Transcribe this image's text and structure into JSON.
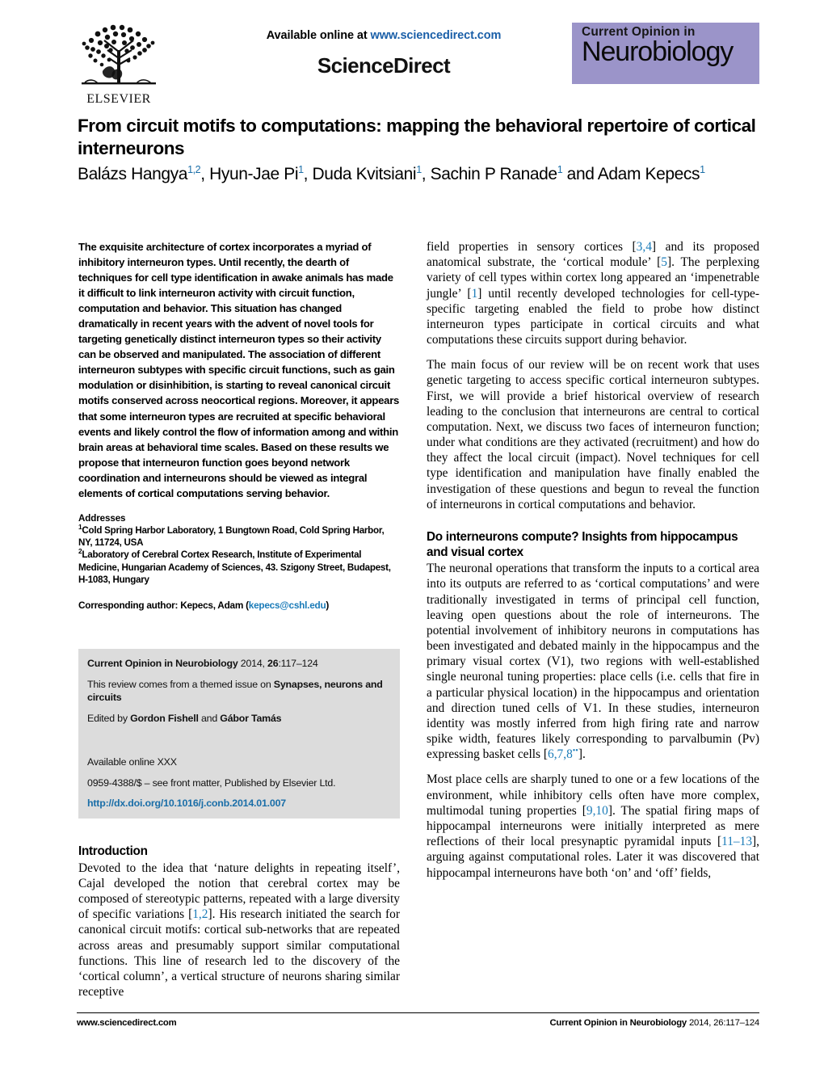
{
  "masthead": {
    "available_online_prefix": "Available online at ",
    "sciencedirect_url": "www.sciencedirect.com",
    "sciencedirect_wordmark": "ScienceDirect",
    "publisher_name": "ELSEVIER",
    "journal_logo_line1": "Current Opinion in",
    "journal_logo_line2": "Neurobiology",
    "journal_logo_bg": "#9b94c9"
  },
  "article": {
    "title": "From circuit motifs to computations: mapping the behavioral repertoire of cortical interneurons",
    "authors_html": "Balázs Hangya<sup>1,2</sup>, Hyun-Jae Pi<sup>1</sup>, Duda Kvitsiani<sup>1</sup>, Sachin P Ranade<sup>1</sup> and Adam Kepecs<sup>1</sup>"
  },
  "abstract": {
    "text": "The exquisite architecture of cortex incorporates a myriad of inhibitory interneuron types. Until recently, the dearth of techniques for cell type identification in awake animals has made it difficult to link interneuron activity with circuit function, computation and behavior. This situation has changed dramatically in recent years with the advent of novel tools for targeting genetically distinct interneuron types so their activity can be observed and manipulated. The association of different interneuron subtypes with specific circuit functions, such as gain modulation or disinhibition, is starting to reveal canonical circuit motifs conserved across neocortical regions. Moreover, it appears that some interneuron types are recruited at specific behavioral events and likely control the flow of information among and within brain areas at behavioral time scales. Based on these results we propose that interneuron function goes beyond network coordination and interneurons should be viewed as integral elements of cortical computations serving behavior."
  },
  "addresses": {
    "heading": "Addresses",
    "address1_marker": "1",
    "address1": "Cold Spring Harbor Laboratory, 1 Bungtown Road, Cold Spring Harbor, NY, 11724, USA",
    "address2_marker": "2",
    "address2": "Laboratory of Cerebral Cortex Research, Institute of Experimental Medicine, Hungarian Academy of Sciences, 43. Szigony Street, Budapest, H-1083, Hungary",
    "corresponding_prefix": "Corresponding author: Kepecs, Adam (",
    "corresponding_email": "kepecs@cshl.edu",
    "corresponding_suffix": ")"
  },
  "citation_box": {
    "journal_bold": "Current Opinion in Neurobiology",
    "citation_rest": " 2014, ",
    "volume_bold": "26",
    "pages": ":117–124",
    "themed_prefix": "This review comes from a themed issue on ",
    "themed_issue_bold": "Synapses, neurons and circuits",
    "edited_prefix": "Edited by ",
    "editor1": "Gordon Fishell",
    "edited_mid": " and ",
    "editor2": "Gábor Tamás",
    "available_online": "Available online XXX",
    "front_matter": "0959-4388/$ – see front matter, Published by Elsevier Ltd.",
    "doi": "http://dx.doi.org/10.1016/j.conb.2014.01.007"
  },
  "sections": {
    "introduction_heading": "Introduction",
    "interneurons_heading": "Do interneurons compute? Insights from hippocampus and visual cortex"
  },
  "paragraphs": {
    "intro_p1_a": "Devoted to the idea that ‘nature delights in repeating itself’, Cajal developed the notion that cerebral cortex may be composed of stereotypic patterns, repeated with a large diversity of specific variations [",
    "intro_p1_ref": "1,2",
    "intro_p1_b": "]. His research initiated the search for canonical circuit motifs: cortical sub-networks that are repeated across areas and presumably support similar computational functions. This line of research led to the discovery of the ‘cortical column’, a vertical structure of neurons sharing similar receptive",
    "right_p1_a": "field properties in sensory cortices [",
    "right_p1_ref1": "3,4",
    "right_p1_b": "] and its proposed anatomical substrate, the ‘cortical module’ [",
    "right_p1_ref2": "5",
    "right_p1_c": "]. The perplexing variety of cell types within cortex long appeared an ‘impenetrable jungle’ [",
    "right_p1_ref3": "1",
    "right_p1_d": "] until recently developed technologies for cell-type-specific targeting enabled the field to probe how distinct interneuron types participate in cortical circuits and what computations these circuits support during behavior.",
    "right_p2": "The main focus of our review will be on recent work that uses genetic targeting to access specific cortical interneuron subtypes. First, we will provide a brief historical overview of research leading to the conclusion that interneurons are central to cortical computation. Next, we discuss two faces of interneuron function; under what conditions are they activated (recruitment) and how do they affect the local circuit (impact). Novel techniques for cell type identification and manipulation have finally enabled the investigation of these questions and begun to reveal the function of interneurons in cortical computations and behavior.",
    "right_p3_a": "The neuronal operations that transform the inputs to a cortical area into its outputs are referred to as ‘cortical computations’ and were traditionally investigated in terms of principal cell function, leaving open questions about the role of interneurons. The potential involvement of inhibitory neurons in computations has been investigated and debated mainly in the hippocampus and the primary visual cortex (V1), two regions with well-established single neuronal tuning properties: place cells (i.e. cells that fire in a particular physical location) in the hippocampus and orientation and direction tuned cells of V1. In these studies, interneuron identity was mostly inferred from high firing rate and narrow spike width, features likely corresponding to parvalbumin (Pv) expressing basket cells [",
    "right_p3_ref": "6,7,8",
    "right_p3_ref_sup": "••",
    "right_p3_b": "].",
    "right_p4_a": "Most place cells are sharply tuned to one or a few locations of the environment, while inhibitory cells often have more complex, multimodal tuning properties [",
    "right_p4_ref1": "9,10",
    "right_p4_b": "]. The spatial firing maps of hippocampal interneurons were initially interpreted as mere reflections of their local presynaptic pyramidal inputs [",
    "right_p4_ref2": "11–13",
    "right_p4_c": "], arguing against computational roles. Later it was discovered that hippocampal interneurons have both ‘on’ and ‘off’ fields,"
  },
  "footer": {
    "left": "www.sciencedirect.com",
    "right_bold": "Current Opinion in Neurobiology",
    "right_rest": " 2014, 26:117–124"
  }
}
